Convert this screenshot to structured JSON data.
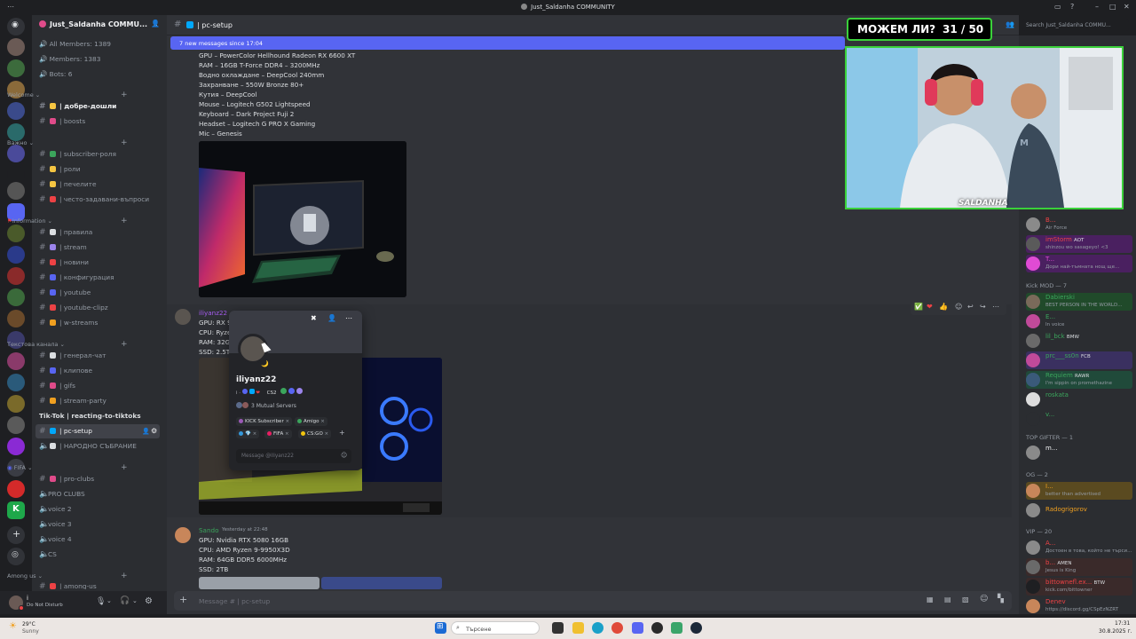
{
  "window": {
    "title": "Just_Saldanha COMMUNITY"
  },
  "server": {
    "name": "Just_Saldanha COMMU...",
    "stats": [
      "All Members: 1389",
      "Members: 1383",
      "Bots: 6"
    ]
  },
  "categories": {
    "welcome": "Welcome",
    "important": "Важно",
    "information": "Information",
    "text": "Текстова канала",
    "fifa": "FIFA",
    "among_us": "Among us"
  },
  "channels": [
    {
      "label": "| добре-дошли",
      "type": "text",
      "emoji_color": "#f5c542",
      "unread": true
    },
    {
      "label": "| boosts",
      "type": "text",
      "emoji_color": "#e04b8a"
    },
    {
      "label": "| subscriber-роля",
      "type": "text",
      "emoji_color": "#3ba55c"
    },
    {
      "label": "| роли",
      "type": "text",
      "emoji_color": "#f5c542"
    },
    {
      "label": "| печелите",
      "type": "text",
      "emoji_color": "#f5c542"
    },
    {
      "label": "| често-задавани-въпроси",
      "type": "text",
      "emoji_color": "#ed4245"
    },
    {
      "label": "| правила",
      "type": "text",
      "emoji_color": "#dbdee1"
    },
    {
      "label": "| stream",
      "type": "text",
      "emoji_color": "#9b84ec"
    },
    {
      "label": "| новини",
      "type": "text",
      "emoji_color": "#ed4245"
    },
    {
      "label": "| конфигурация",
      "type": "text",
      "emoji_color": "#5865f2"
    },
    {
      "label": "| youtube",
      "type": "text",
      "emoji_color": "#5865f2"
    },
    {
      "label": "| youtube-clipz",
      "type": "text",
      "emoji_color": "#ed4245"
    },
    {
      "label": "| w-streams",
      "type": "text",
      "emoji_color": "#f0a020"
    },
    {
      "label": "| генерал-чат",
      "type": "text",
      "emoji_color": "#dbdee1"
    },
    {
      "label": "| клипове",
      "type": "text",
      "emoji_color": "#5865f2"
    },
    {
      "label": "| gifs",
      "type": "text",
      "emoji_color": "#e04b8a"
    },
    {
      "label": "| stream-party",
      "type": "text",
      "emoji_color": "#f0a020"
    },
    {
      "label": "Tik-Tok | reacting-to-tiktoks",
      "type": "text",
      "emoji_color": "#2b2d31"
    },
    {
      "label": "| pc-setup",
      "type": "text",
      "emoji_color": "#00a8fc",
      "active": true
    },
    {
      "label": "| НАРОДНО СЪБРАНИЕ",
      "type": "voice",
      "emoji_color": "#dbdee1"
    },
    {
      "label": "| pro-clubs",
      "type": "text",
      "emoji_color": "#e04b8a"
    },
    {
      "label": "PRO CLUBS",
      "type": "voice"
    },
    {
      "label": "voice 2",
      "type": "voice"
    },
    {
      "label": "voice 3",
      "type": "voice"
    },
    {
      "label": "voice 4",
      "type": "voice"
    },
    {
      "label": "CS",
      "type": "voice"
    },
    {
      "label": "| among-us",
      "type": "text",
      "emoji_color": "#ed4245"
    }
  ],
  "user_panel": {
    "name": "i",
    "status": "Do Not Disturb"
  },
  "header": {
    "channel": "| pc-setup",
    "search_placeholder": "Search Just_Saldanha COMMU..."
  },
  "banner": {
    "new_messages": "7 new messages since 17:04"
  },
  "messages": {
    "m1_lines": [
      "GPU – PowerColor Hellhound Radeon RX 6600 XT",
      "RAM – 16GB T-Force DDR4 – 3200MHz",
      "Водно охлаждане – DeepCool 240mm",
      "Захранване – 550W Bronze 80+",
      "Кутия – DeepCool",
      "Mouse – Logitech G502 Lightspeed",
      "Keyboard – Dark Project Fuji 2",
      "Headset – Logitech G PRO X Gaming",
      "Mic – Genesis"
    ],
    "m2_author": "iliyanz22",
    "m2_lines": [
      "GPU: RX 9",
      "CPU: Ryze",
      "RAM: 32G",
      "SSD: 2.5T"
    ],
    "m3_author": "Sando",
    "m3_time": "Yesterday at 22:48",
    "m3_lines": [
      "GPU: Nvidia RTX 5080 16GB",
      "CPU: AMD Ryzen 9-9950X3D",
      "RAM: 64GB DDR5 6000MHz",
      "SSD: 2TB"
    ]
  },
  "profile_popup": {
    "username": "iliyanz22",
    "mutual": "3 Mutual Servers",
    "roles": [
      {
        "name": "KICK Subscriber",
        "color": "#9b59b6"
      },
      {
        "name": "Amigo",
        "color": "#3ba55c"
      },
      {
        "name": "",
        "color": "#3498db"
      },
      {
        "name": "FIFA",
        "color": "#e91e63"
      },
      {
        "name": "CS:GO",
        "color": "#f1c40f"
      }
    ],
    "message_placeholder": "Message @iliyanz22",
    "badge": "CS2"
  },
  "composer": {
    "placeholder": "Message #  | pc-setup"
  },
  "overlay": {
    "poll_text": "МОЖЕМ ЛИ?",
    "count": "31 / 50",
    "streamer": "SALDANHA"
  },
  "member_groups": [
    {
      "heading": "",
      "members": [
        {
          "name": "B...",
          "status": "Air Force",
          "color": "#ed4245"
        },
        {
          "name": "imStorm",
          "badge": "AOT",
          "status": "shinzou wo sasageyo! <3",
          "color": "#ed4245"
        },
        {
          "name": "T...",
          "status": "Дори най-тъмната нощ ще...",
          "color": "#e04bd4"
        }
      ]
    },
    {
      "heading": "Kick MOD — 7",
      "members": [
        {
          "name": "Dabierski",
          "status": "BEST PERSON IN THE WORLD...",
          "color": "#3ba55c"
        },
        {
          "name": "E...",
          "status": "In voice",
          "color": "#3ba55c"
        },
        {
          "name": "lil_bck",
          "badge": "BMW",
          "status": "",
          "color": "#3ba55c"
        },
        {
          "name": "prc___ss0n",
          "badge": "FCB",
          "status": "",
          "color": "#3ba55c"
        },
        {
          "name": "Requiem",
          "badge": "RAWR",
          "status": "I'm sippin on promethazine",
          "color": "#3ba55c"
        },
        {
          "name": "roskata",
          "status": "",
          "color": "#3ba55c"
        },
        {
          "name": "v...",
          "status": "",
          "color": "#3ba55c"
        }
      ]
    },
    {
      "heading": "TOP GIFTER — 1",
      "members": [
        {
          "name": "m...",
          "status": "",
          "color": "#f2f3f5"
        }
      ]
    },
    {
      "heading": "OG — 2",
      "members": [
        {
          "name": "I...",
          "status": "better than advertised",
          "color": "#f0a020"
        },
        {
          "name": "Radogrigorov",
          "status": "",
          "color": "#f0a020"
        }
      ]
    },
    {
      "heading": "VIP — 20",
      "members": [
        {
          "name": "A...",
          "status": "Достоен в това, който не търси...",
          "color": "#ed4245"
        },
        {
          "name": "b...",
          "badge": "AMEN",
          "status": "Jesus is King",
          "color": "#ed4245"
        },
        {
          "name": "bittownefl.ex...",
          "badge": "BTW",
          "status": "kick.com/bittowner",
          "color": "#ed4245"
        },
        {
          "name": "Denev",
          "status": "https://discord.gg/CSpEzNZRT",
          "color": "#ed4245"
        }
      ]
    }
  ],
  "taskbar": {
    "weather_temp": "29°C",
    "weather_desc": "Sunny",
    "search_placeholder": "Търсене",
    "time": "17:31",
    "date": "30.8.2025 г."
  }
}
